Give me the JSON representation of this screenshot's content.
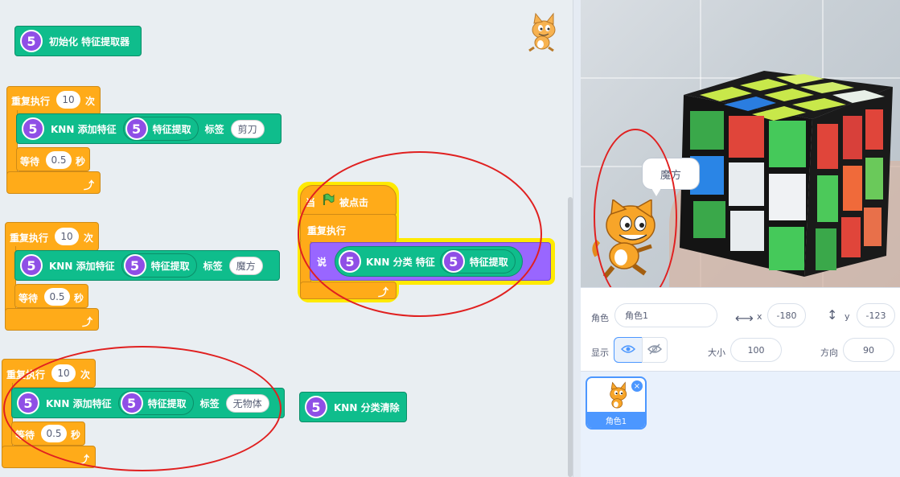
{
  "code_area": {
    "init_block": {
      "label": "初始化 特征提取器",
      "icon": "5"
    },
    "loop1": {
      "repeat_label": "重复执行",
      "count": "10",
      "unit": "次",
      "knn_label": "KNN 添加特征",
      "feature_label": "特征提取",
      "tag_label": "标签",
      "tag_value": "剪刀",
      "wait_label": "等待",
      "wait_value": "0.5",
      "wait_unit": "秒",
      "icon": "5"
    },
    "loop2": {
      "repeat_label": "重复执行",
      "count": "10",
      "unit": "次",
      "knn_label": "KNN 添加特征",
      "feature_label": "特征提取",
      "tag_label": "标签",
      "tag_value": "魔方",
      "wait_label": "等待",
      "wait_value": "0.5",
      "wait_unit": "秒",
      "icon": "5"
    },
    "loop3": {
      "repeat_label": "重复执行",
      "count": "10",
      "unit": "次",
      "knn_label": "KNN 添加特征",
      "feature_label": "特征提取",
      "tag_label": "标签",
      "tag_value": "无物体",
      "wait_label": "等待",
      "wait_value": "0.5",
      "wait_unit": "秒",
      "icon": "5"
    },
    "hat_script": {
      "when_label": "当",
      "flag_icon": "green-flag-icon",
      "clicked_label": "被点击",
      "forever_label": "重复执行",
      "say_label": "说",
      "classify_label": "KNN 分类 特征",
      "feature_label": "特征提取",
      "icon": "5"
    },
    "clear_block": {
      "label": "KNN 分类清除",
      "icon": "5"
    },
    "loop_arrow": "⤴"
  },
  "stage": {
    "speech_text": "魔方"
  },
  "sprite_info": {
    "sprite_label": "角色",
    "sprite_name": "角色1",
    "x_label": "x",
    "x_value": "-180",
    "y_label": "y",
    "y_value": "-123",
    "show_label": "显示",
    "size_label": "大小",
    "size_value": "100",
    "direction_label": "方向",
    "direction_value": "90"
  },
  "sprite_list": {
    "items": [
      {
        "name": "角色1"
      }
    ]
  },
  "colors": {
    "control": "#ffab19",
    "extension": "#0fbd8c",
    "looks": "#9966ff",
    "highlight": "#ffea00",
    "annotation": "#e02020",
    "accent": "#4c97ff"
  }
}
